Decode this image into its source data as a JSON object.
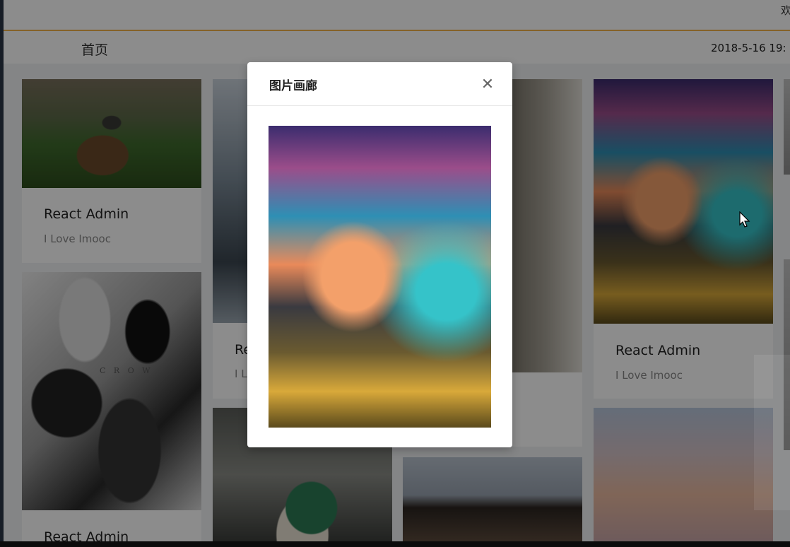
{
  "header": {
    "welcome_text": "欢",
    "breadcrumb": "首页",
    "datetime": "2018-5-16 19:"
  },
  "gallery": {
    "cards": [
      {
        "title": "React Admin",
        "subtitle": "I Love Imooc"
      },
      {
        "title": "React Admin",
        "subtitle": ""
      },
      {
        "title": "Re",
        "subtitle": "I L"
      },
      {
        "title": "React Admin",
        "subtitle": "I Love Imooc"
      }
    ],
    "crow_caption": "C R O W"
  },
  "modal": {
    "title": "图片画廊",
    "close_glyph": "✕"
  },
  "icons": {
    "close": "close-icon",
    "cursor": "mouse-pointer-icon"
  },
  "colors": {
    "header_accent": "#f3b24a",
    "mask": "rgba(0,0,0,0.45)"
  }
}
